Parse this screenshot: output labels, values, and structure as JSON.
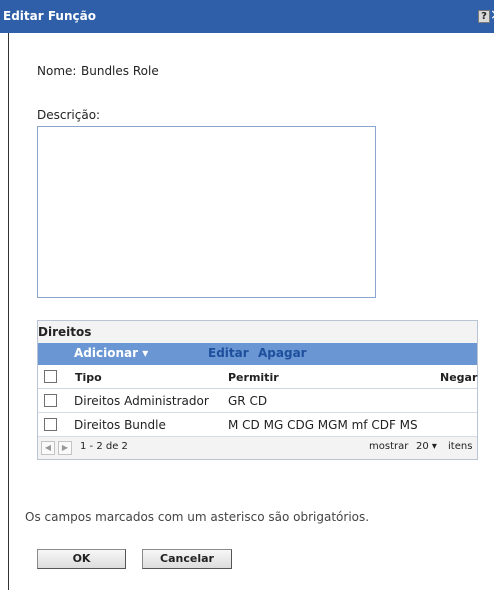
{
  "dialog": {
    "title": "Editar Função",
    "help_label": "?",
    "close_label": "×"
  },
  "form": {
    "name_label": "Nome:",
    "name_value": "Bundles Role",
    "description_label": "Descrição:",
    "description_value": ""
  },
  "rights": {
    "title": "Direitos",
    "toolbar": {
      "add_label": "Adicionar ▾",
      "edit_label": "Editar",
      "delete_label": "Apagar"
    },
    "columns": {
      "type": "Tipo",
      "allow": "Permitir",
      "deny": "Negar"
    },
    "rows": [
      {
        "type": "Direitos Administrador",
        "allow": "GR CD",
        "deny": ""
      },
      {
        "type": "Direitos Bundle",
        "allow": "M CD MG CDG MGM mf CDF MS",
        "deny": ""
      }
    ],
    "pager": {
      "range": "1 - 2 de 2",
      "show_label": "mostrar",
      "page_size": "20 ▾",
      "items_label": "itens"
    }
  },
  "note": "Os campos marcados com um asterisco são obrigatórios.",
  "buttons": {
    "ok_label": "OK",
    "cancel_label": "Cancelar"
  }
}
